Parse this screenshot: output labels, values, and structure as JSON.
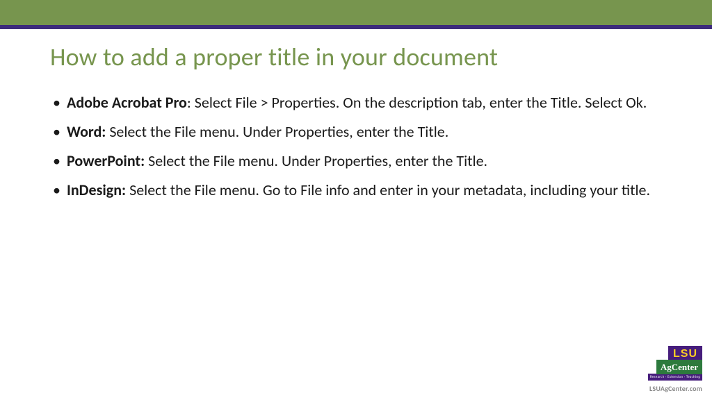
{
  "slide": {
    "title": "How to add a proper title in your document",
    "bullets": [
      {
        "label": "Adobe Acrobat Pro",
        "sep": ": ",
        "text": "Select File > Properties. On the description tab, enter the Title. Select Ok."
      },
      {
        "label": "Word:",
        "sep": " ",
        "text": "Select the File menu. Under Properties, enter the Title."
      },
      {
        "label": "PowerPoint:",
        "sep": " ",
        "text": "Select the File menu. Under Properties, enter the Title."
      },
      {
        "label": "InDesign:",
        "sep": " ",
        "text": "Select the File menu. Go to File info and enter in your metadata, including your title."
      }
    ]
  },
  "footer": {
    "logo_lsu": "LSU",
    "logo_ag": "AgCenter",
    "logo_sub": "Research · Extension · Teaching",
    "url": "LSUAgCenter.com"
  }
}
